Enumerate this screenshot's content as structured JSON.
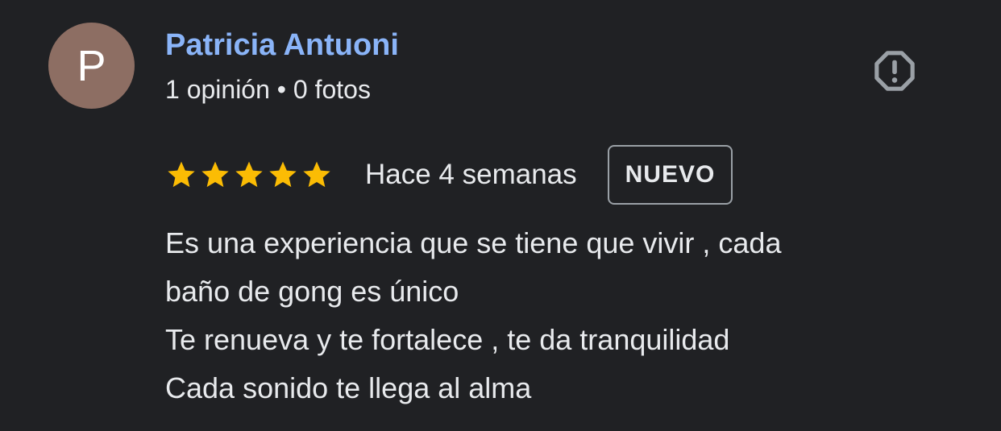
{
  "review": {
    "author": {
      "initial": "P",
      "name": "Patricia Antuoni",
      "meta": "1 opinión • 0 fotos",
      "avatar_color": "#8d6e63"
    },
    "report_icon": "report-flag-octagon-icon",
    "rating": {
      "value": 5,
      "max": 5,
      "star_color": "#fbbc04"
    },
    "date": "Hace 4 semanas",
    "badge": "NUEVO",
    "text_lines": [
      "Es una experiencia que se tiene que vivir , cada",
      "baño de gong es único",
      "Te renueva y te fortalece , te da tranquilidad",
      "Cada sonido te llega al alma"
    ]
  },
  "colors": {
    "background": "#202124",
    "name_link": "#8ab4f8",
    "text": "#e8eaed",
    "icon_gray": "#9aa0a6"
  }
}
